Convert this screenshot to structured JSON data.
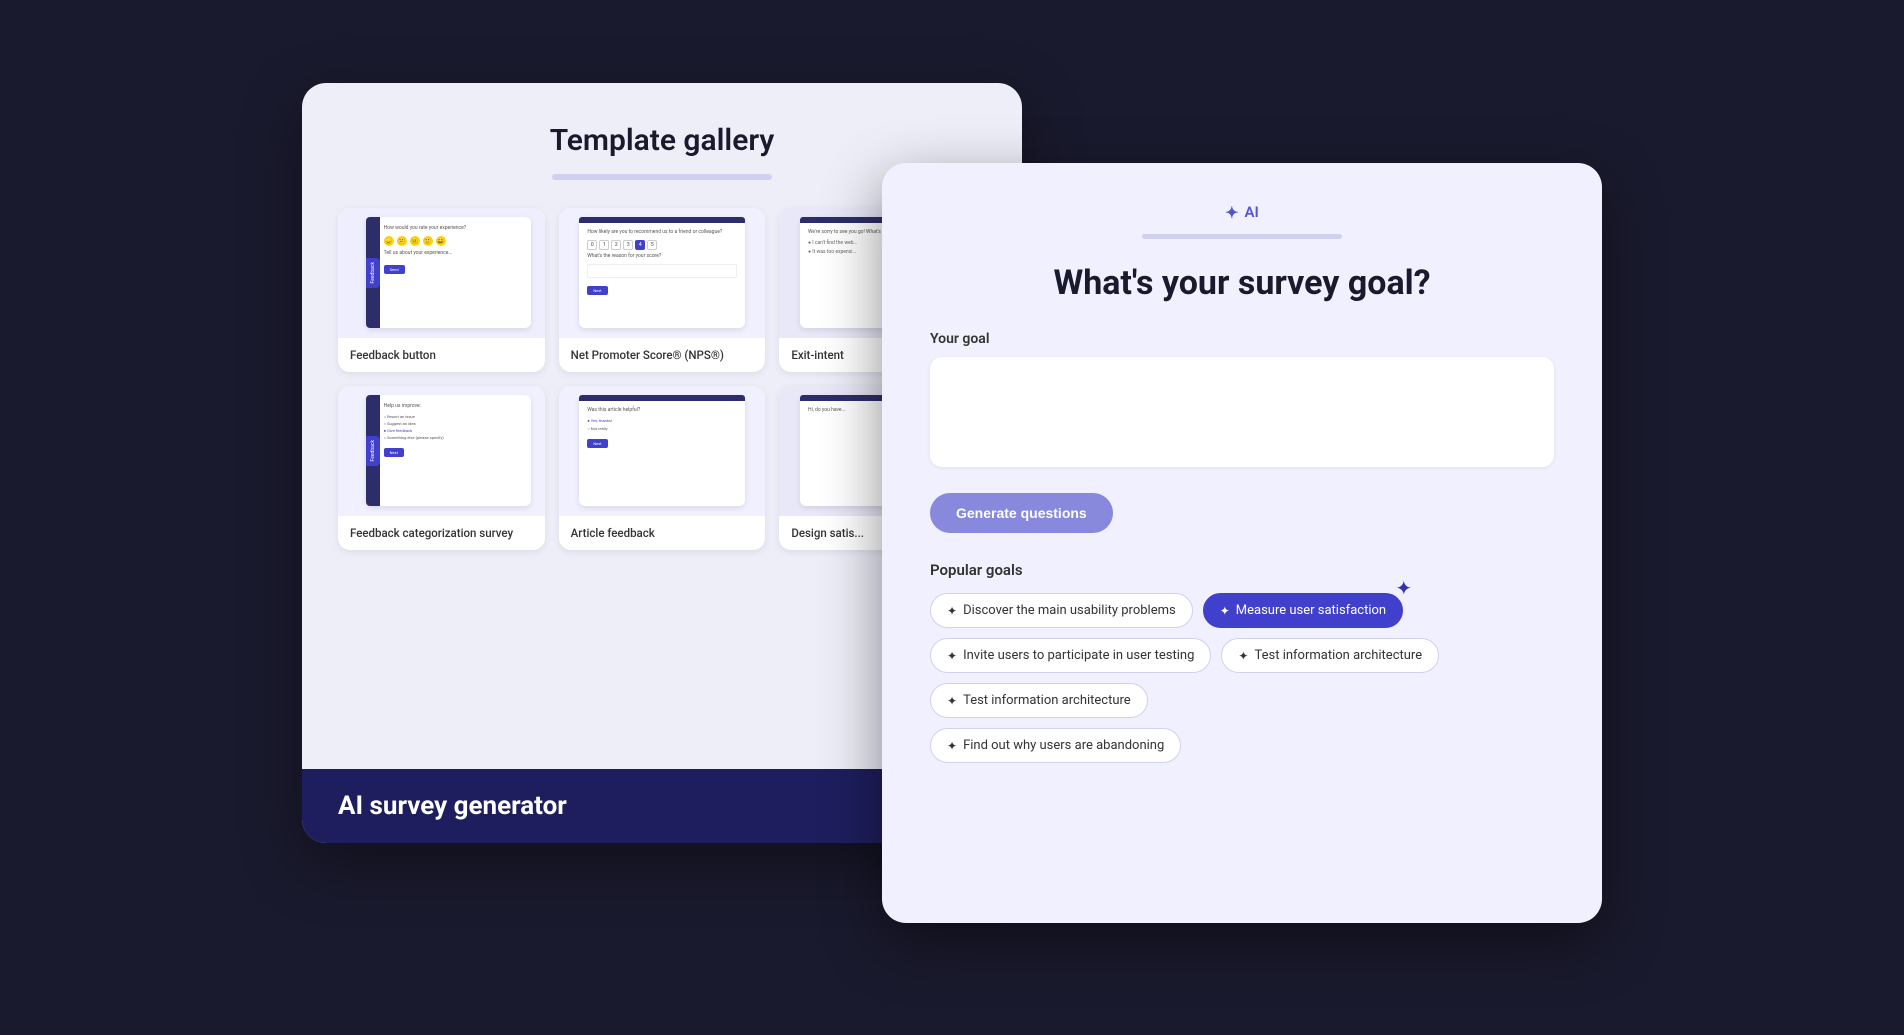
{
  "templateGallery": {
    "title": "Template gallery",
    "items": [
      {
        "label": "Feedback button",
        "type": "feedback"
      },
      {
        "label": "Net Promoter Score® (NPS®)",
        "type": "nps"
      },
      {
        "label": "Exit-intent",
        "type": "exit"
      },
      {
        "label": "Feedback categorization survey",
        "type": "feedback-cat"
      },
      {
        "label": "Article feedback",
        "type": "article"
      },
      {
        "label": "Design satis...",
        "type": "design"
      }
    ],
    "banner": "AI survey generator"
  },
  "aiSurvey": {
    "badge": "AI",
    "progressBarVisible": true,
    "mainTitle": "What's your survey goal?",
    "yourGoalLabel": "Your goal",
    "textareaPlaceholder": "",
    "generateBtnLabel": "Generate questions",
    "popularGoalsTitle": "Popular goals",
    "goals": [
      {
        "label": "Discover the main usability problems",
        "active": false
      },
      {
        "label": "Measure user satisfaction",
        "active": true
      },
      {
        "label": "Invite users to participate in user testing",
        "active": false
      },
      {
        "label": "Test information architecture",
        "active": false
      },
      {
        "label": "Test information architecture",
        "active": false
      },
      {
        "label": "Find out why users are abandoning",
        "active": false
      }
    ]
  }
}
